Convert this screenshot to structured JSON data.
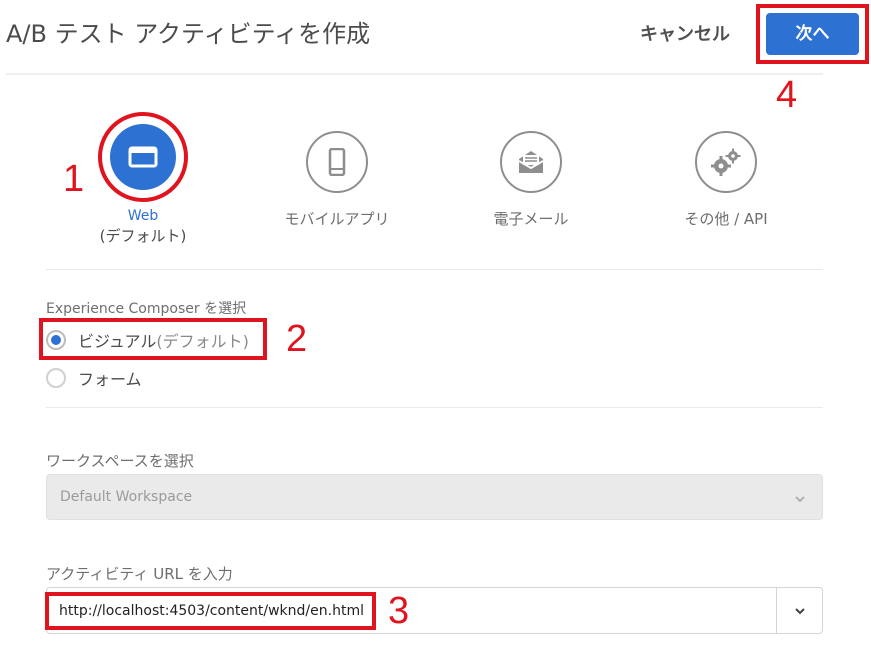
{
  "header": {
    "title": "A/B テスト アクティビティを作成",
    "cancel_label": "キャンセル",
    "next_label": "次へ"
  },
  "channels": [
    {
      "label": "Web",
      "sublabel": "(デフォルト)",
      "icon": "browser-window-icon",
      "selected": true
    },
    {
      "label": "モバイルアプリ",
      "icon": "mobile-phone-icon",
      "selected": false
    },
    {
      "label": "電子メール",
      "icon": "envelope-icon",
      "selected": false
    },
    {
      "label": "その他 / API",
      "icon": "gears-icon",
      "selected": false
    }
  ],
  "composer": {
    "label": "Experience Composer を選択",
    "options": [
      {
        "label": "ビジュアル",
        "suffix": "(デフォルト)",
        "checked": true
      },
      {
        "label": "フォーム",
        "checked": false
      }
    ]
  },
  "workspace": {
    "label": "ワークスペースを選択",
    "value": "Default Workspace"
  },
  "activity_url": {
    "label": "アクティビティ URL を入力",
    "value": "http://localhost:4503/content/wknd/en.html"
  },
  "callouts": [
    "1",
    "2",
    "3",
    "4"
  ],
  "colors": {
    "accent": "#2d72d2",
    "callout": "#e0141e"
  }
}
